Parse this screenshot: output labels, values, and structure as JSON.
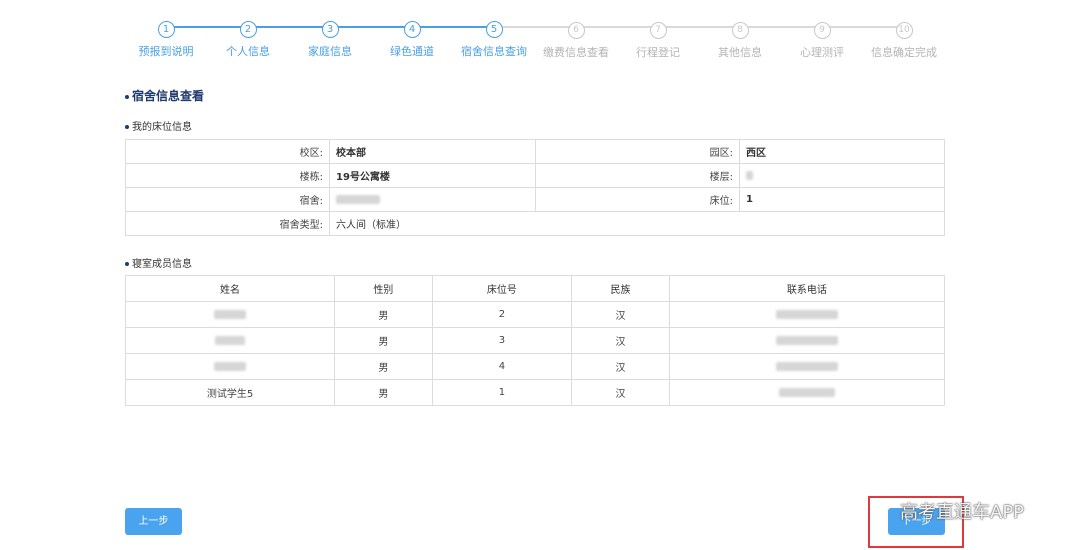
{
  "steps": [
    {
      "num": "1",
      "label": "预报到说明",
      "done": true
    },
    {
      "num": "2",
      "label": "个人信息",
      "done": true
    },
    {
      "num": "3",
      "label": "家庭信息",
      "done": true
    },
    {
      "num": "4",
      "label": "绿色通道",
      "done": true
    },
    {
      "num": "5",
      "label": "宿舍信息查询",
      "done": true
    },
    {
      "num": "6",
      "label": "缴费信息查看",
      "done": false
    },
    {
      "num": "7",
      "label": "行程登记",
      "done": false
    },
    {
      "num": "8",
      "label": "其他信息",
      "done": false
    },
    {
      "num": "9",
      "label": "心理测评",
      "done": false
    },
    {
      "num": "10",
      "label": "信息确定完成",
      "done": false
    }
  ],
  "section_title": "宿舍信息查看",
  "bed_info": {
    "subtitle": "我的床位信息",
    "campus_label": "校区:",
    "campus_value": "校本部",
    "area_label": "园区:",
    "area_value": "西区",
    "building_label": "楼栋:",
    "building_value": "19号公寓楼",
    "floor_label": "楼层:",
    "floor_value": "",
    "dorm_label": "宿舍:",
    "dorm_value": "",
    "bed_label": "床位:",
    "bed_value": "1",
    "type_label": "宿舍类型:",
    "type_value": "六人间（标准）"
  },
  "members": {
    "subtitle": "寝室成员信息",
    "headers": [
      "姓名",
      "性别",
      "床位号",
      "民族",
      "联系电话"
    ],
    "rows": [
      {
        "name": "",
        "gender": "男",
        "bed": "2",
        "ethnicity": "汉",
        "phone": ""
      },
      {
        "name": "",
        "gender": "男",
        "bed": "3",
        "ethnicity": "汉",
        "phone": ""
      },
      {
        "name": "",
        "gender": "男",
        "bed": "4",
        "ethnicity": "汉",
        "phone": ""
      },
      {
        "name": "测试学生5",
        "gender": "男",
        "bed": "1",
        "ethnicity": "汉",
        "phone": ""
      }
    ]
  },
  "buttons": {
    "prev": "上一步",
    "next": "下一步"
  },
  "watermark": "高考直通车APP",
  "colors": {
    "accent": "#4a9fe6",
    "inactive": "#c8c8c8",
    "highlight": "#e0393b"
  }
}
